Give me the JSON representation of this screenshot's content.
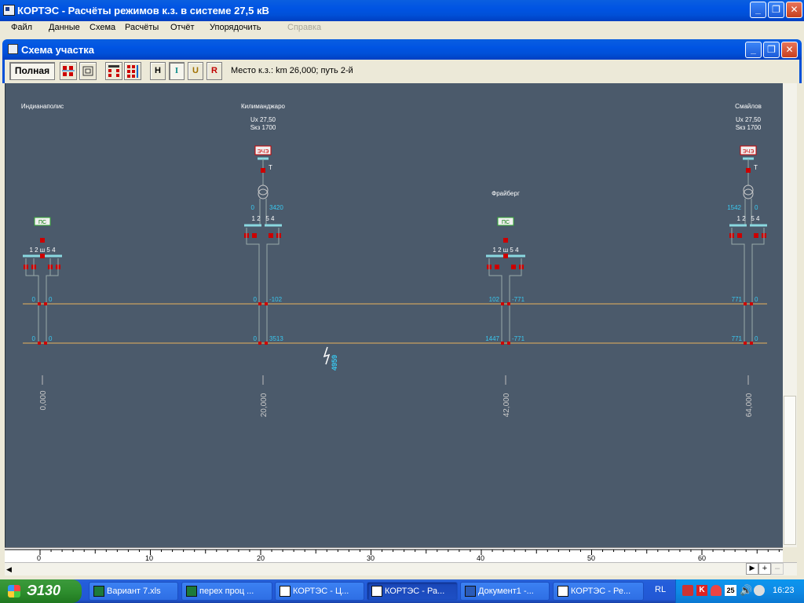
{
  "window": {
    "title": "КОРТЭС - Расчёты режимов к.з. в системе 27,5 кВ",
    "min": "_",
    "max": "❐",
    "close": "✕"
  },
  "menu": [
    "Файл",
    "Данные",
    "Схема",
    "Расчёты",
    "Отчёт",
    "Упорядочить",
    "Справка"
  ],
  "child": {
    "title": "Схема участка"
  },
  "toolbar": {
    "full_label": "Полная",
    "h_label": "H",
    "i_label": "I",
    "u_label": "U",
    "r_label": "R",
    "fault_info": "Место к.з.:  km 26,000;  путь 2-й"
  },
  "schema": {
    "stations": [
      {
        "name": "Индианаполис",
        "type_label": "ПС",
        "km": "0,000",
        "tracks_label": "1 2 ш 5 4"
      },
      {
        "name": "Килиманджаро",
        "ux": "Ux 27,50",
        "skz": "Sкз 1700",
        "source_label": "ЭЧЭ",
        "transformer_label": "Т",
        "km": "20,000",
        "left_val": "0",
        "right_val": "3420",
        "tracks_label": "1 2   5 4"
      },
      {
        "name": "Фрайберг",
        "type_label": "ПС",
        "km": "42,000",
        "tracks_label": "1 2 ш 5 4"
      },
      {
        "name": "Смайлов",
        "ux": "Ux 27,50",
        "skz": "Sкз 1700",
        "source_label": "ЭЧЭ",
        "transformer_label": "Т",
        "km": "64,000",
        "left_val": "1542",
        "right_val": "0",
        "tracks_label": "1 2   5 4"
      }
    ],
    "line1_values": [
      {
        "l": "0",
        "r": "0"
      },
      {
        "l": "0",
        "r": "-102"
      },
      {
        "l": "102",
        "r": "-771"
      },
      {
        "l": "771",
        "r": "0"
      }
    ],
    "line2_values": [
      {
        "l": "0",
        "r": "0"
      },
      {
        "l": "0",
        "r": "3513"
      },
      {
        "l": "1447",
        "r": "-771"
      },
      {
        "l": "771",
        "r": "0"
      }
    ],
    "fault_current": "4959"
  },
  "ruler": {
    "ticks": [
      "0",
      "10",
      "20",
      "30",
      "40",
      "50",
      "60"
    ]
  },
  "taskbar": {
    "start": "Э130",
    "tasks": [
      "Вариант 7.xls",
      "перех проц ...",
      "КОРТЭС - Ц...",
      "КОРТЭС - Ра...",
      "Документ1 -...",
      "КОРТЭС - Ре..."
    ],
    "lang": "RL",
    "clock": "16:23"
  },
  "colors": {
    "canvas": "#4b5a6b",
    "bus_line": "#e8b35c",
    "value_text": "#39c8f0",
    "switch_red": "#cc0000",
    "busbar": "#8ad8e0"
  }
}
